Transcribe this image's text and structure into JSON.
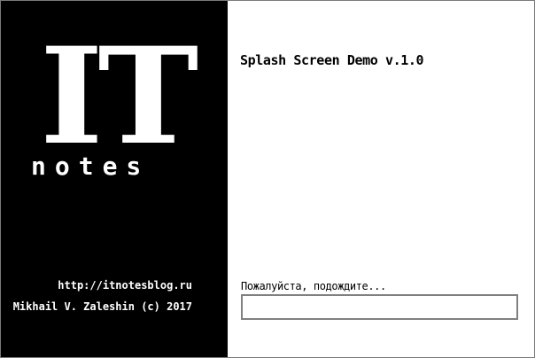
{
  "window": {
    "type": "splash-screen"
  },
  "logo": {
    "big_text": "IT",
    "small_text": "notes"
  },
  "credits": {
    "url": "http://itnotesblog.ru",
    "copyright": "Mikhail V. Zaleshin (c) 2017"
  },
  "app": {
    "title": "Splash Screen Demo v.1.0"
  },
  "loading": {
    "label": "Пожалуйста, подождите...",
    "progress": 0
  },
  "colors": {
    "left_panel": "#000000",
    "right_panel": "#ffffff",
    "progress_border": "#808080"
  }
}
